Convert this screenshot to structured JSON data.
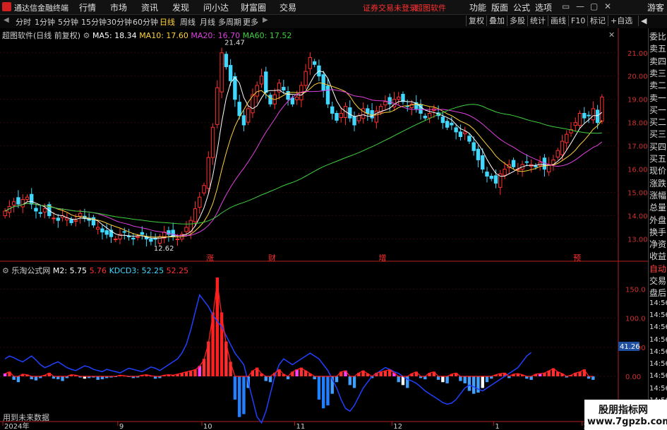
{
  "app": {
    "title": "通达信金融终端",
    "warning": "证券交易未登录",
    "brand": "超图软件",
    "guest": "游客"
  },
  "menu": [
    "行情",
    "市场",
    "资讯",
    "发现",
    "问小达",
    "财富圈",
    "交易"
  ],
  "right_menu": [
    "功能",
    "版面",
    "公式",
    "选项"
  ],
  "window_buttons": [
    "▭",
    "—",
    "▢",
    "✕"
  ],
  "periods": [
    "分时",
    "1分钟",
    "5分钟",
    "15分钟",
    "30分钟",
    "60分钟",
    "日线",
    "周线",
    "月线",
    "多周期",
    "更多"
  ],
  "active_period": "日线",
  "tools": [
    "复权",
    "叠加",
    "多股",
    "统计",
    "画线",
    "F10",
    "标记",
    "+自选",
    "◀"
  ],
  "chart_title": "超图软件(日线 前复权)",
  "ma": [
    {
      "label": "MA5: 18.34",
      "color": "#ffffff"
    },
    {
      "label": "MA10: 17.60",
      "color": "#ffd23c"
    },
    {
      "label": "MA20: 16.70",
      "color": "#e040e0"
    },
    {
      "label": "MA60: 17.52",
      "color": "#40d040"
    }
  ],
  "indicator": {
    "name": "乐淘公式网",
    "m2": "M2: 5.75",
    "m2_val": "5.76",
    "kdcd": "KDCD3: 52.25",
    "kdcd_val": "52.25"
  },
  "price_axis": [
    "21.00",
    "20.00",
    "19.00",
    "18.00",
    "17.00",
    "16.00",
    "15.00",
    "14.00",
    "13.00"
  ],
  "ind_axis": [
    "150.0",
    "100.0",
    "50.00",
    "0.00"
  ],
  "ind_badge": "41.26",
  "annotations": {
    "high": "21.47",
    "low": "12.62"
  },
  "events": [
    {
      "label": "涨",
      "date_index": 46
    },
    {
      "label": "财",
      "date_index": 60
    },
    {
      "label": "增",
      "date_index": 85
    },
    {
      "label": "预",
      "date_index": 129
    }
  ],
  "side_panel": [
    "委比",
    "卖五",
    "卖四",
    "卖三",
    "卖二",
    "卖一",
    "买一",
    "买二",
    "买三",
    "买四",
    "买五",
    "现价",
    "涨跌",
    "涨幅",
    "总量",
    "外盘",
    "换手",
    "净资",
    "收益",
    "自动",
    "交易",
    "盘后",
    "14:56",
    "14:56",
    "14:56",
    "14:56",
    "14:56",
    "14:56",
    "14:56",
    "14:56",
    "14:56"
  ],
  "side_red": [
    "自动"
  ],
  "bottom_note": "用到未来数据",
  "date_axis": [
    {
      "label": "2024年",
      "date_index": 0
    },
    {
      "label": "9",
      "date_index": 26
    },
    {
      "label": "10",
      "date_index": 45
    },
    {
      "label": "11",
      "date_index": 66
    },
    {
      "label": "12",
      "date_index": 88
    },
    {
      "label": "1",
      "date_index": 111
    },
    {
      "label": "2",
      "date_index": 131
    }
  ],
  "watermark": {
    "line1": "股朋指标网",
    "line2": "www.7gpzb.com"
  },
  "colors": {
    "up": "#ff3030",
    "down": "#40d8ff",
    "ma5": "#ffffff",
    "ma10": "#ffd23c",
    "ma20": "#e040e0",
    "ma60": "#40d040"
  },
  "chart_data": {
    "type": "candlestick",
    "price_range": [
      12.5,
      21.6
    ],
    "closes": [
      14.2,
      14.4,
      14.6,
      14.5,
      14.7,
      14.8,
      14.5,
      14.2,
      14.1,
      14.3,
      14.0,
      13.9,
      13.8,
      14.0,
      13.9,
      13.7,
      13.8,
      14.1,
      13.9,
      13.8,
      13.6,
      13.5,
      13.3,
      13.2,
      13.1,
      13.0,
      13.2,
      13.3,
      13.1,
      13.0,
      13.1,
      13.2,
      13.0,
      12.9,
      13.0,
      13.1,
      13.3,
      13.2,
      13.1,
      13.0,
      13.2,
      13.5,
      13.8,
      14.3,
      14.8,
      15.3,
      16.5,
      17.8,
      19.5,
      21.0,
      20.4,
      19.8,
      19.0,
      18.3,
      17.9,
      18.6,
      19.2,
      19.6,
      20.0,
      19.3,
      18.8,
      19.2,
      19.7,
      19.4,
      19.0,
      18.8,
      19.1,
      19.6,
      20.2,
      20.8,
      20.5,
      20.0,
      19.4,
      18.8,
      18.4,
      18.1,
      18.4,
      18.7,
      18.2,
      17.9,
      18.3,
      18.6,
      18.4,
      18.2,
      18.5,
      18.7,
      18.9,
      18.8,
      19.0,
      19.1,
      18.9,
      18.7,
      18.8,
      18.6,
      18.4,
      18.2,
      18.4,
      18.6,
      18.3,
      18.0,
      17.8,
      17.9,
      17.6,
      17.4,
      17.6,
      17.2,
      16.8,
      16.4,
      16.0,
      15.7,
      15.6,
      15.4,
      15.8,
      16.0,
      16.2,
      16.1,
      16.0,
      16.2,
      16.3,
      16.2,
      16.1,
      16.3,
      16.0,
      16.2,
      16.4,
      16.8,
      17.2,
      17.5,
      17.7,
      18.0,
      18.4,
      18.2,
      18.3,
      18.6,
      18.0,
      19.1
    ],
    "m2": [
      5,
      8,
      -6,
      -10,
      4,
      3,
      -5,
      -7,
      -3,
      2,
      6,
      -4,
      -5,
      -8,
      -3,
      3,
      2,
      -2,
      -4,
      -3,
      -2,
      -6,
      -5,
      -3,
      -2,
      -1,
      2,
      1,
      -1,
      -3,
      -2,
      2,
      3,
      1,
      -4,
      -3,
      2,
      3,
      2,
      4,
      6,
      8,
      10,
      12,
      18,
      30,
      60,
      110,
      170,
      110,
      60,
      25,
      -40,
      -70,
      -65,
      -20,
      10,
      15,
      5,
      -8,
      -10,
      6,
      12,
      4,
      -5,
      8,
      12,
      15,
      10,
      5,
      -5,
      -40,
      -55,
      -50,
      -30,
      -10,
      8,
      10,
      -15,
      -20,
      6,
      10,
      5,
      -3,
      6,
      8,
      10,
      12,
      6,
      -10,
      -15,
      -20,
      5,
      8,
      -3,
      -5,
      6,
      8,
      -6,
      -10,
      -12,
      4,
      6,
      -8,
      -12,
      -25,
      -30,
      -28,
      -20,
      -10,
      -4,
      3,
      5,
      6,
      -3,
      4,
      5,
      3,
      -4,
      -6,
      4,
      5,
      6,
      10,
      14,
      8,
      5,
      -2,
      2,
      6,
      8,
      12,
      -4,
      -6
    ],
    "kdcd3": [
      30,
      35,
      32,
      28,
      25,
      30,
      35,
      28,
      20,
      15,
      18,
      22,
      25,
      20,
      15,
      12,
      10,
      14,
      18,
      16,
      12,
      10,
      8,
      12,
      10,
      8,
      6,
      10,
      14,
      12,
      10,
      8,
      12,
      16,
      14,
      10,
      15,
      20,
      25,
      30,
      40,
      55,
      80,
      110,
      140,
      130,
      120,
      105,
      95,
      85,
      70,
      55,
      40,
      30,
      20,
      -10,
      -40,
      -70,
      -80,
      -60,
      -30,
      0,
      20,
      30,
      25,
      20,
      25,
      30,
      35,
      40,
      35,
      30,
      20,
      10,
      -5,
      -20,
      -40,
      -55,
      -60,
      -50,
      -35,
      -20,
      -10,
      0,
      5,
      10,
      15,
      12,
      8,
      5,
      0,
      -5,
      -8,
      -12,
      -18,
      -25,
      -30,
      -35,
      -40,
      -45,
      -48,
      -46,
      -40,
      -30,
      -20,
      -15,
      -18,
      -22,
      -25,
      -20,
      -15,
      -10,
      -5,
      0,
      5,
      10,
      15,
      25,
      35,
      41
    ]
  }
}
